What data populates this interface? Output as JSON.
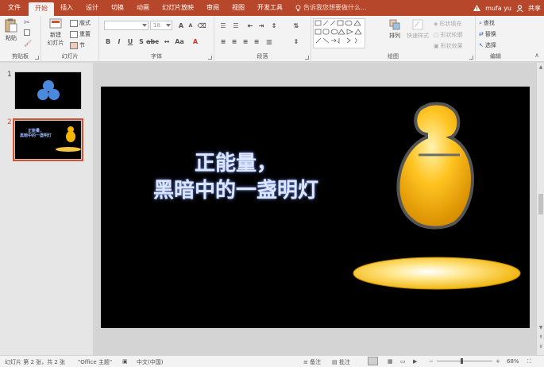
{
  "menu": {
    "tabs": [
      "文件",
      "开始",
      "插入",
      "设计",
      "切换",
      "动画",
      "幻灯片放映",
      "审阅",
      "视图",
      "开发工具"
    ],
    "active_tab": "开始",
    "tellme": "告诉我您想要做什么...",
    "warning_icon": "warning-icon",
    "user": "mufa yu",
    "share": "共享"
  },
  "ribbon": {
    "clipboard": {
      "paste": "粘贴",
      "label": "剪贴板"
    },
    "slides": {
      "new_slide_line1": "新建",
      "new_slide_line2": "幻灯片",
      "layout": "版式",
      "reset": "重置",
      "section": "节",
      "label": "幻灯片"
    },
    "font": {
      "font_size": "18",
      "label": "字体"
    },
    "paragraph": {
      "label": "段落"
    },
    "drawing": {
      "arrange": "排列",
      "quick_styles": "快速样式",
      "shape_fill": "形状填充",
      "shape_outline": "形状轮廓",
      "shape_effects": "形状效果",
      "label": "绘图"
    },
    "editing": {
      "find": "查找",
      "replace": "替换",
      "select": "选择",
      "label": "编辑"
    }
  },
  "thumbnails": [
    {
      "number": "1",
      "selected": false
    },
    {
      "number": "2",
      "selected": true,
      "caption_line1": "正能量，",
      "caption_line2": "黑暗中的一盏明灯"
    }
  ],
  "slide": {
    "title_line1": "正能量，",
    "title_line2": "黑暗中的一盏明灯"
  },
  "status": {
    "slide_info": "幻灯片 第 2 张，共 2 张",
    "theme": "\"Office 主题\"",
    "language": "中文(中国)",
    "notes": "备注",
    "comments": "批注",
    "zoom": "68%"
  },
  "colors": {
    "accent": "#b7472a",
    "slide_background": "#000000",
    "title_glow": "#7d9cff",
    "bulb": "#f7b500"
  }
}
